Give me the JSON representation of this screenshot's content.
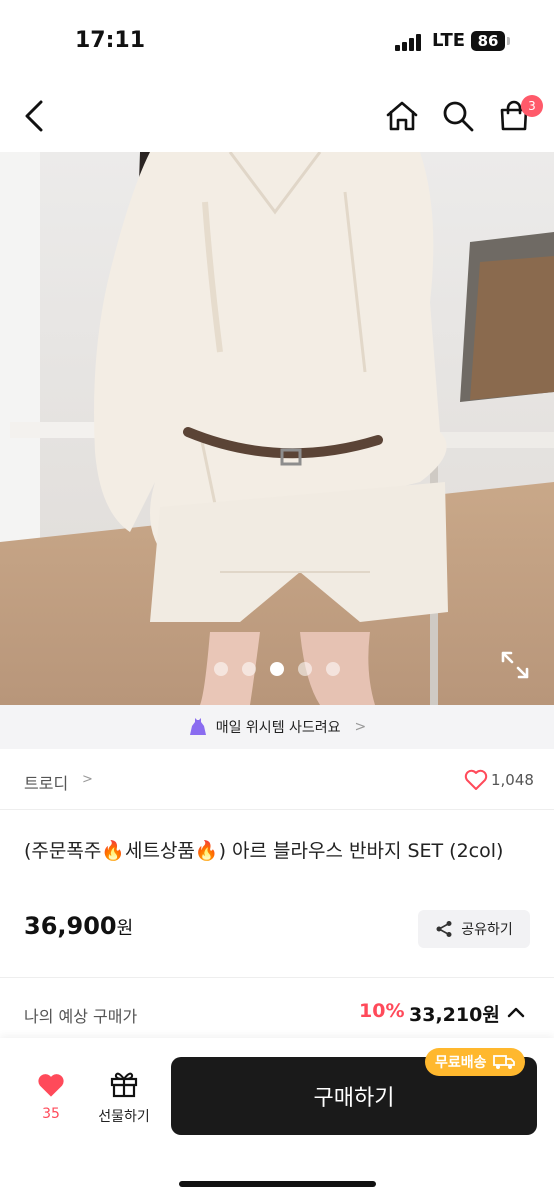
{
  "status_bar": {
    "time": "17:11",
    "network": "LTE",
    "battery": "86"
  },
  "nav": {
    "cart_count": "3"
  },
  "gallery": {
    "dot_count": 5,
    "active_index": 2
  },
  "banner": {
    "text": "매일 위시템 사드려요"
  },
  "brand": {
    "name": "트로디",
    "likes": "1,048"
  },
  "product": {
    "title": "(주문폭주🔥세트상품🔥) 아르 블라우스 반바지 SET (2col)",
    "price": "36,900",
    "price_unit": "원",
    "share_label": "공유하기"
  },
  "expected": {
    "label": "나의 예상 구매가",
    "discount": "10%",
    "price": "33,210원"
  },
  "bottom_bar": {
    "wish_count": "35",
    "gift_label": "선물하기",
    "buy_label": "구매하기",
    "shipping_badge": "무료배송"
  },
  "colors": {
    "accent": "#ff4a5a",
    "badge": "#ff5a6a",
    "shipping": "#ffb82e",
    "buy": "#1a1a1a"
  }
}
